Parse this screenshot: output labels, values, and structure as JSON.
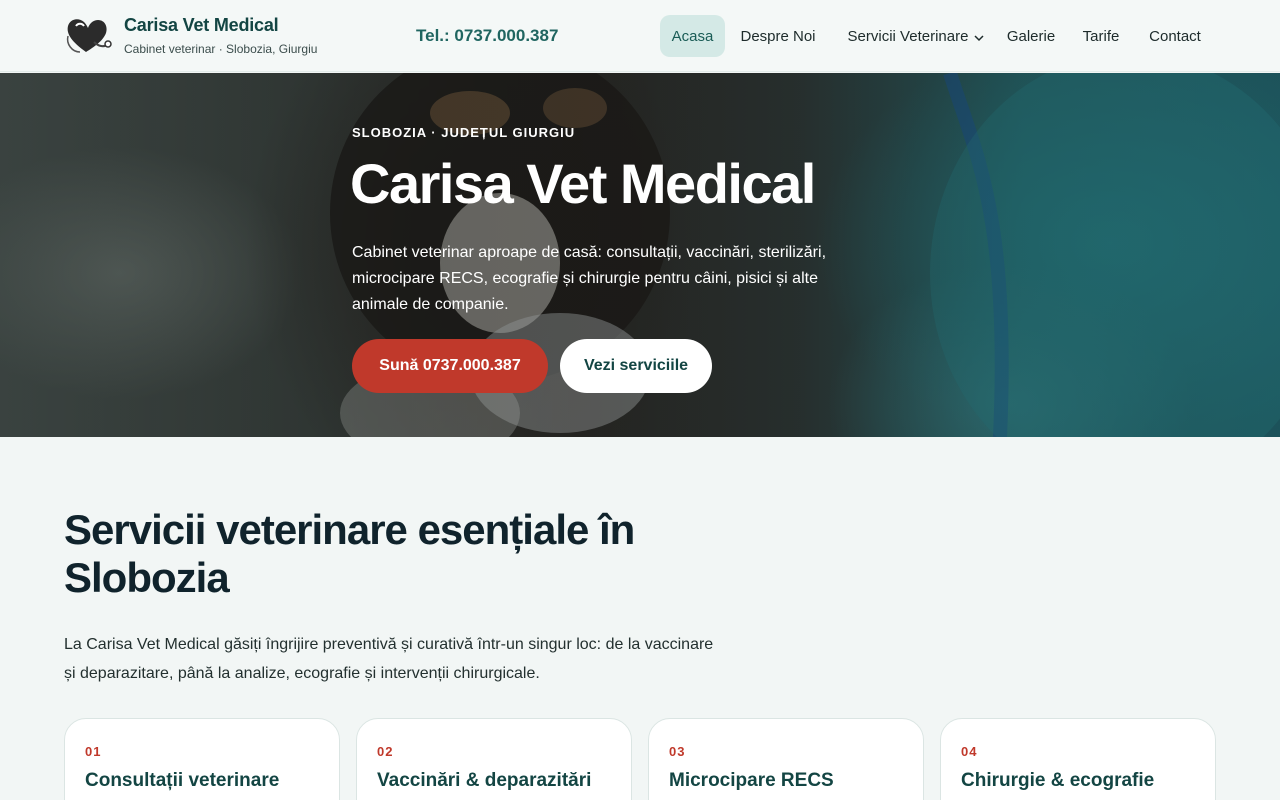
{
  "header": {
    "brand_name": "Carisa Vet Medical",
    "brand_tagline": "Cabinet veterinar · Slobozia, Giurgiu",
    "phone_label": "Tel.: 0737.000.387",
    "nav": [
      {
        "label": "Acasa",
        "active": true
      },
      {
        "label": "Despre Noi",
        "active": false
      },
      {
        "label": "Servicii Veterinare",
        "active": false,
        "has_dropdown": true
      },
      {
        "label": "Galerie",
        "active": false
      },
      {
        "label": "Tarife",
        "active": false
      },
      {
        "label": "Contact",
        "active": false
      }
    ]
  },
  "hero": {
    "eyebrow": "SLOBOZIA · JUDEȚUL GIURGIU",
    "title": "Carisa Vet Medical",
    "description": "Cabinet veterinar aproape de casă: consultații, vaccinări, sterilizări, microcipare RECS, ecografie și chirurgie pentru câini, pisici și alte animale de companie.",
    "primary_button": "Sună 0737.000.387",
    "secondary_button": "Vezi serviciile"
  },
  "services": {
    "title": "Servicii veterinare esențiale în Slobozia",
    "description": "La Carisa Vet Medical găsiți îngrijire preventivă și curativă într-un singur loc: de la vaccinare și deparazitare, până la analize, ecografie și intervenții chirurgicale.",
    "cards": [
      {
        "number": "01",
        "title": "Consultații veterinare"
      },
      {
        "number": "02",
        "title": "Vaccinări & deparazitări"
      },
      {
        "number": "03",
        "title": "Microcipare RECS"
      },
      {
        "number": "04",
        "title": "Chirurgie & ecografie"
      }
    ]
  },
  "colors": {
    "brand_dark": "#134543",
    "accent_red": "#c0392b",
    "nav_active_bg": "#d4e9e6",
    "page_bg": "#f2f6f5"
  },
  "icons": {
    "logo": "heart-stethoscope-logo",
    "dropdown": "chevron-down-icon"
  }
}
